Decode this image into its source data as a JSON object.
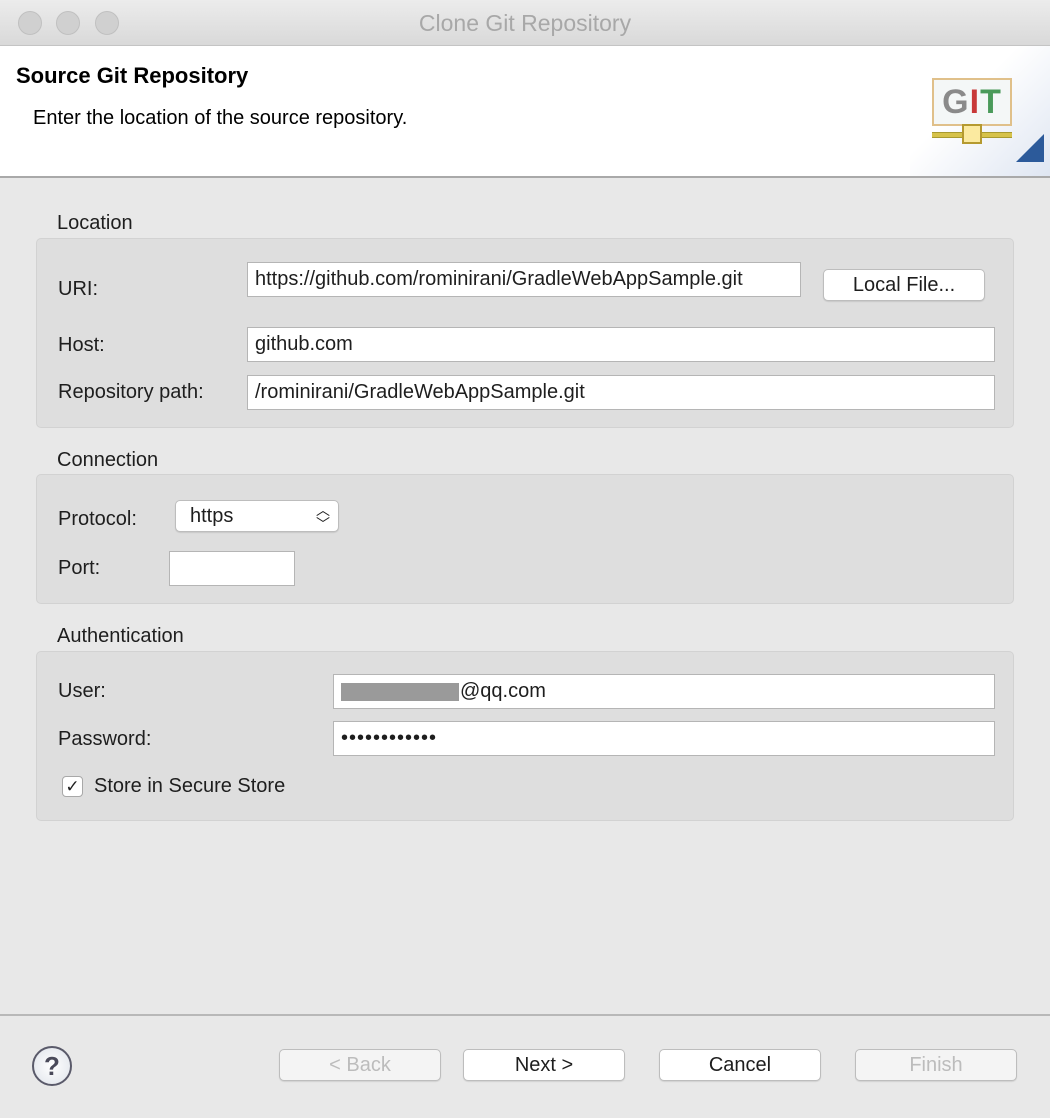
{
  "window": {
    "title": "Clone Git Repository"
  },
  "header": {
    "title": "Source Git Repository",
    "description": "Enter the location of the source repository.",
    "logo_text": "GIT"
  },
  "location": {
    "group_label": "Location",
    "uri_label": "URI:",
    "uri_value": "https://github.com/rominirani/GradleWebAppSample.git",
    "local_file_button": "Local File...",
    "host_label": "Host:",
    "host_value": "github.com",
    "path_label": "Repository path:",
    "path_value": "/rominirani/GradleWebAppSample.git"
  },
  "connection": {
    "group_label": "Connection",
    "protocol_label": "Protocol:",
    "protocol_value": "https",
    "port_label": "Port:",
    "port_value": ""
  },
  "authentication": {
    "group_label": "Authentication",
    "user_label": "User:",
    "user_value_visible": "@qq.com",
    "password_label": "Password:",
    "password_value": "••••••••••••",
    "store_label": "Store in Secure Store",
    "store_checked": true
  },
  "footer": {
    "help_icon": "?",
    "back": "< Back",
    "next": "Next >",
    "cancel": "Cancel",
    "finish": "Finish"
  }
}
